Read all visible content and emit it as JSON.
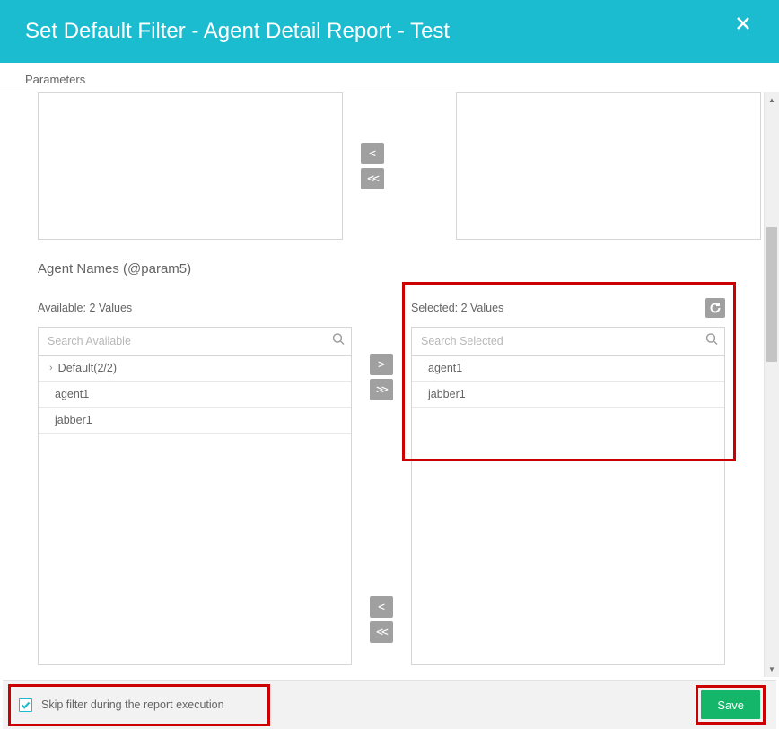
{
  "dialog": {
    "title": "Set Default Filter - Agent Detail Report - Test"
  },
  "tab": {
    "label": "Parameters"
  },
  "section": {
    "title": "Agent Names (@param5)",
    "available": {
      "header": "Available: 2 Values",
      "search_placeholder": "Search Available",
      "group_label": "Default(2/2)",
      "items": [
        "agent1",
        "jabber1"
      ]
    },
    "selected": {
      "header": "Selected: 2 Values",
      "search_placeholder": "Search Selected",
      "items": [
        "agent1",
        "jabber1"
      ]
    }
  },
  "transfer": {
    "move_right": ">",
    "move_all_right": ">>",
    "move_left": "<",
    "move_all_left": "<<"
  },
  "footer": {
    "skip_label": "Skip filter during the report execution",
    "skip_checked": true,
    "save_label": "Save"
  }
}
